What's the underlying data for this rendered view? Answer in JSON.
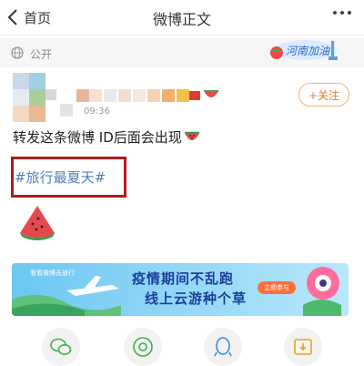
{
  "nav": {
    "back_label": "首页",
    "title": "微博正文"
  },
  "visibility": {
    "label": "公开"
  },
  "badge": {
    "text": "河南加油"
  },
  "post": {
    "time": "09:36",
    "follow_label": "+关注",
    "text": "转发这条微博 ID后面会出现",
    "topic": "#旅行最夏天#"
  },
  "banner": {
    "tag": "看看微博去旅行",
    "line1": "疫情期间不乱跑",
    "line2": "线上云游种个草",
    "join": "立即参与"
  },
  "share_icons": [
    "wechat-icon",
    "moments-icon",
    "qq-icon",
    "save-image-icon"
  ],
  "colors": {
    "accent": "#ec7a29",
    "topic": "#4f7fb6",
    "highlight_box": "#b01a1a",
    "banner": "#8fd3f4"
  }
}
